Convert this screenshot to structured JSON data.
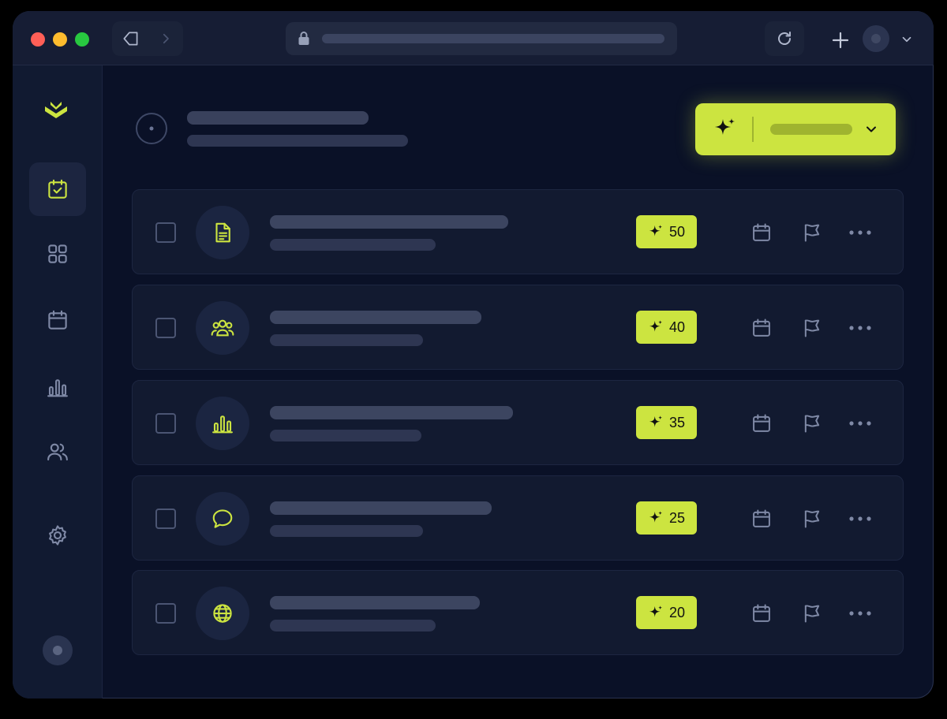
{
  "colors": {
    "accent": "#cce440",
    "background": "#0a1127",
    "titlebar": "#161d34",
    "traffic_red": "#ff5f57",
    "traffic_yellow": "#febc2e",
    "traffic_green": "#28c840"
  },
  "browser": {
    "icons": [
      "back-icon",
      "forward-icon",
      "lock-icon",
      "reload-icon",
      "plus-icon",
      "profile-avatar",
      "chevron-down-icon"
    ]
  },
  "sidebar": {
    "items": [
      {
        "icon": "calendar-check-icon",
        "active": true
      },
      {
        "icon": "grid-icon",
        "active": false
      },
      {
        "icon": "calendar-icon",
        "active": false
      },
      {
        "icon": "bar-chart-icon",
        "active": false
      },
      {
        "icon": "users-icon",
        "active": false
      },
      {
        "icon": "settings-icon",
        "active": false
      }
    ]
  },
  "tasks": [
    {
      "icon": "document-icon",
      "score": "50"
    },
    {
      "icon": "users-icon",
      "score": "40"
    },
    {
      "icon": "bar-chart-icon",
      "score": "35"
    },
    {
      "icon": "chat-bubble-icon",
      "score": "25"
    },
    {
      "icon": "globe-icon",
      "score": "20"
    }
  ]
}
